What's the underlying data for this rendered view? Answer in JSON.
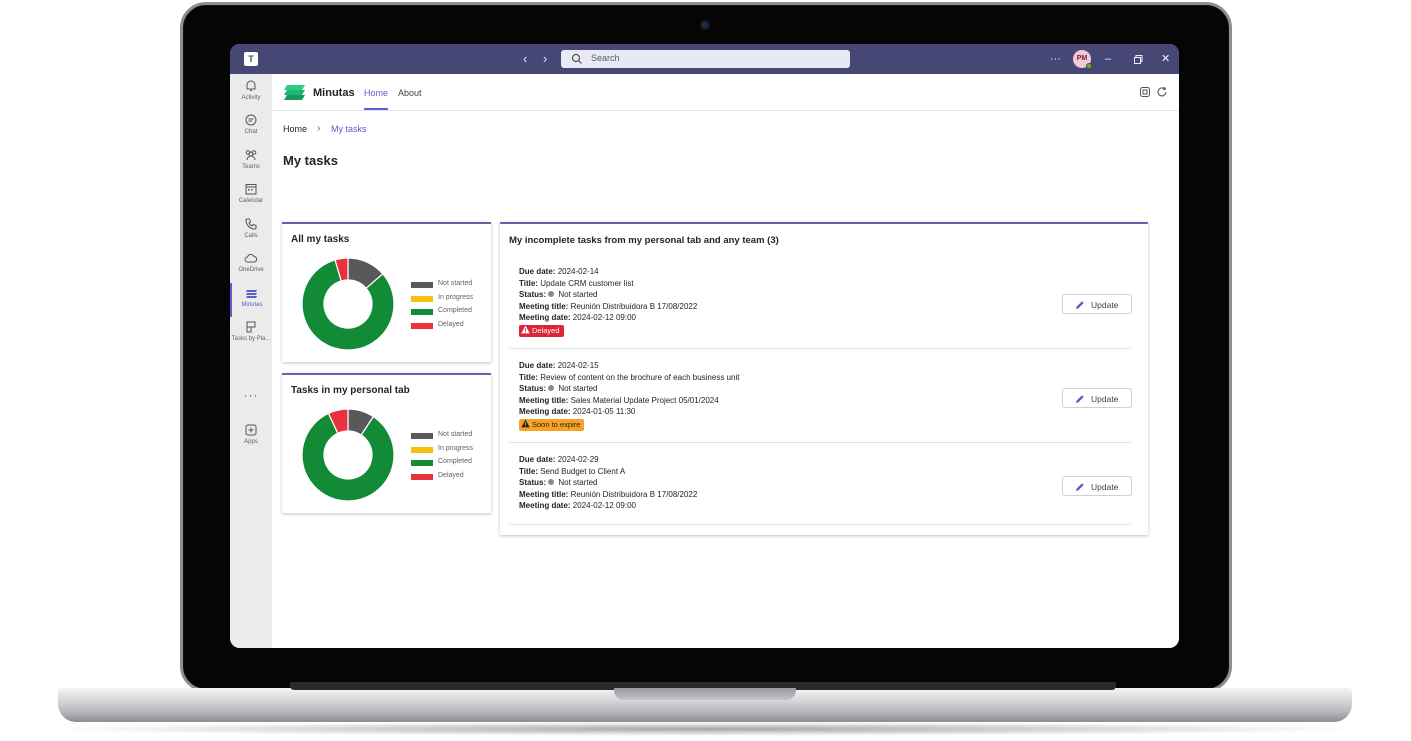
{
  "topbar": {
    "search_placeholder": "Search",
    "more": "···",
    "avatar_initials": "PM"
  },
  "rail": {
    "items": [
      {
        "label": "Activity",
        "icon": "bell-icon"
      },
      {
        "label": "Chat",
        "icon": "chat-icon"
      },
      {
        "label": "Teams",
        "icon": "teams-icon"
      },
      {
        "label": "Calendar",
        "icon": "calendar-icon"
      },
      {
        "label": "Calls",
        "icon": "phone-icon"
      },
      {
        "label": "OneDrive",
        "icon": "cloud-icon"
      },
      {
        "label": "Minutas",
        "icon": "minutas-icon"
      },
      {
        "label": "Tasks by Pla...",
        "icon": "planner-icon"
      },
      {
        "label": "Apps",
        "icon": "add-app-icon"
      }
    ],
    "more": "···"
  },
  "app": {
    "name": "Minutas",
    "tabs": [
      {
        "label": "Home",
        "active": true
      },
      {
        "label": "About",
        "active": false
      }
    ]
  },
  "breadcrumb": {
    "home": "Home",
    "current": "My tasks"
  },
  "page_title": "My tasks",
  "legend_labels": [
    "Not started",
    "In progress",
    "Completed",
    "Delayed"
  ],
  "colors": {
    "not_started": "#595959",
    "in_progress": "#f2c20f",
    "completed": "#138a36",
    "delayed": "#e8333f",
    "accent": "#5b5fc7",
    "topbar": "#464775"
  },
  "chart_data": [
    {
      "type": "pie",
      "title": "All my tasks",
      "categories": [
        "Not started",
        "In progress",
        "Completed",
        "Delayed"
      ],
      "values": [
        3,
        0,
        18,
        1
      ]
    },
    {
      "type": "pie",
      "title": "Tasks in my personal tab",
      "categories": [
        "Not started",
        "In progress",
        "Completed",
        "Delayed"
      ],
      "values": [
        2,
        0,
        18,
        1.5
      ]
    }
  ],
  "tasks_panel": {
    "title": "My incomplete tasks from my personal tab and any team (3)",
    "labels": {
      "due": "Due date:",
      "title": "Title:",
      "status": "Status:",
      "meeting_title": "Meeting title:",
      "meeting_date": "Meeting date:",
      "update": "Update"
    },
    "tasks": [
      {
        "due_date": "2024-02-14",
        "title": "Update CRM customer list",
        "status": "Not started",
        "meeting_title": "Reunión Distribuidora B 17/08/2022",
        "meeting_date": "2024-02-12 09:00",
        "badge": "Delayed"
      },
      {
        "due_date": "2024-02-15",
        "title": "Review of content on the brochure of each business unit",
        "status": "Not started",
        "meeting_title": "Sales Material Update Project 05/01/2024",
        "meeting_date": "2024-01-05 11:30",
        "badge": "Soon to expire"
      },
      {
        "due_date": "2024-02-29",
        "title": "Send Budget to Client A",
        "status": "Not started",
        "meeting_title": "Reunión Distribuidora B 17/08/2022",
        "meeting_date": "2024-02-12 09:00",
        "badge": ""
      }
    ]
  }
}
